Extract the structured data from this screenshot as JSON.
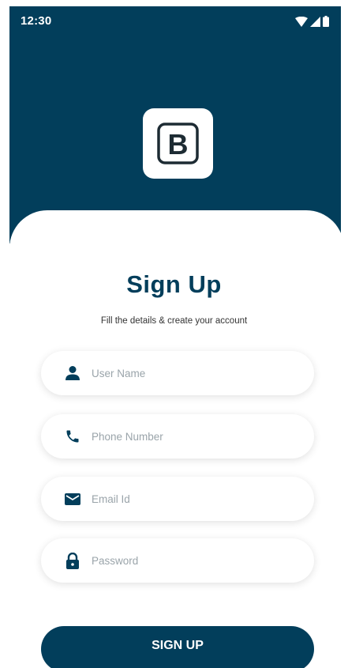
{
  "status_bar": {
    "time": "12:30"
  },
  "logo": {
    "letter": "B"
  },
  "title": "Sign Up",
  "subtitle": "Fill the details & create your account",
  "form": {
    "fields": [
      {
        "icon": "person-icon",
        "placeholder": "User Name",
        "value": ""
      },
      {
        "icon": "phone-icon",
        "placeholder": "Phone Number",
        "value": ""
      },
      {
        "icon": "mail-icon",
        "placeholder": "Email Id",
        "value": ""
      },
      {
        "icon": "lock-icon",
        "placeholder": "Password",
        "value": ""
      }
    ],
    "submit_label": "SIGN UP"
  },
  "colors": {
    "primary": "#023e5b",
    "background": "#ffffff",
    "placeholder": "#9aa4aa"
  }
}
